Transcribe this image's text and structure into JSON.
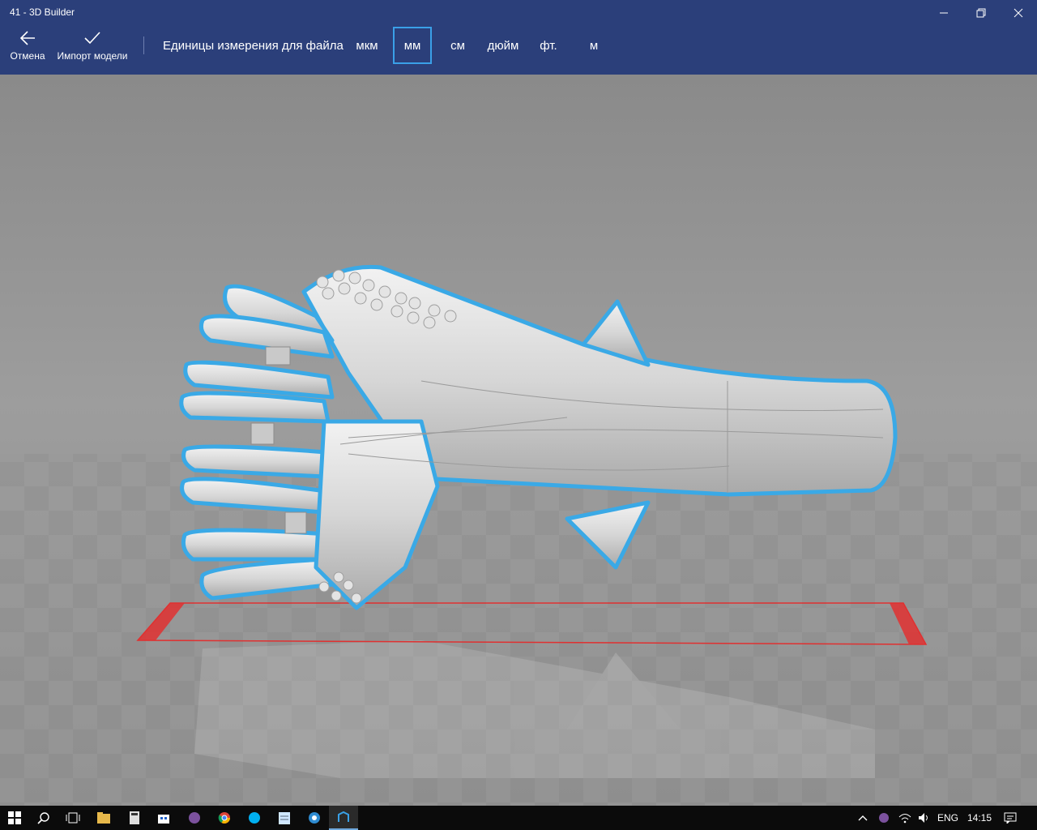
{
  "window": {
    "title": "41 - 3D Builder"
  },
  "toolbar": {
    "cancel_label": "Отмена",
    "import_label": "Импорт модели",
    "units_label": "Единицы измерения для файла",
    "units": [
      "мкм",
      "мм",
      "см",
      "дюйм",
      "фт.",
      "м"
    ],
    "selected_unit": "мм"
  },
  "viewport": {
    "accent_color": "#3aa9e6",
    "bounds_color": "#e03030",
    "background_color": "#8d8d8d"
  },
  "taskbar": {
    "pinned": [
      "file-explorer-icon",
      "calculator-icon",
      "store-icon",
      "viber-icon",
      "chrome-icon",
      "skype-icon",
      "notepad-icon",
      "browser-icon",
      "3d-builder-icon"
    ],
    "language": "ENG",
    "time": "14:15"
  }
}
